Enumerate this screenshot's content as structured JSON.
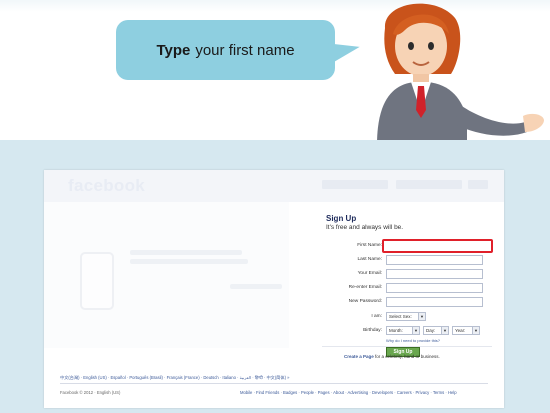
{
  "instruction": {
    "bold": "Type",
    "rest": "your first name"
  },
  "fb": {
    "logo": "facebook",
    "signup": {
      "title": "Sign Up",
      "subtitle": "It's free and always will be.",
      "fields": [
        {
          "label": "First Name:"
        },
        {
          "label": "Last Name:"
        },
        {
          "label": "Your Email:"
        },
        {
          "label": "Re-enter Email:"
        },
        {
          "label": "New Password:"
        }
      ],
      "gender_label": "I am:",
      "gender_select": "Select Sex:",
      "birthday_label": "Birthday:",
      "month_select": "Month:",
      "day_select": "Day:",
      "year_select": "Year:",
      "why_link": "Why do I need to provide this?",
      "button": "Sign Up",
      "create_page_bold": "Create a Page",
      "create_page_rest": "for a celebrity, band or business."
    },
    "languages": "中文(台灣) · English (US) · Español · Português (Brasil) · Français (France) · Deutsch · Italiano · العربية · हिन्दी · 中文(简体) »",
    "footer_left": "Facebook © 2012 · English (US)",
    "footer_right": "Mobile · Find Friends · Badges · People · Pages · About · Advertising · Developers · Careers · Privacy · Terms · Help"
  }
}
